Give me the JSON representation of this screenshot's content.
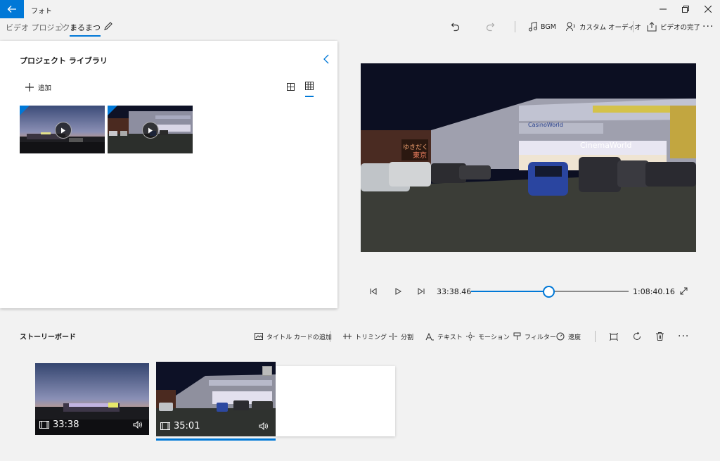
{
  "app": {
    "title": "フォト"
  },
  "header": {
    "breadcrumb_root": "ビデオ プロジェクト",
    "project_name": "まるまつ"
  },
  "toolbar": {
    "bgm": "BGM",
    "custom_audio": "カスタム オーディオ",
    "finish_video": "ビデオの完了"
  },
  "library": {
    "title": "プロジェクト ライブラリ",
    "add_label": "追加"
  },
  "player": {
    "current_time": "33:38.46",
    "total_time": "1:08:40.16",
    "progress": 0.49
  },
  "storyboard": {
    "title": "ストーリーボード",
    "tools": {
      "add_title_card": "タイトル カードの追加",
      "trim": "トリミング",
      "split": "分割",
      "text": "テキスト",
      "motion": "モーション",
      "filter": "フィルター",
      "speed": "速度"
    },
    "clips": [
      {
        "duration": "33:38"
      },
      {
        "duration": "35:01"
      }
    ]
  },
  "colors": {
    "accent": "#0078d7"
  }
}
